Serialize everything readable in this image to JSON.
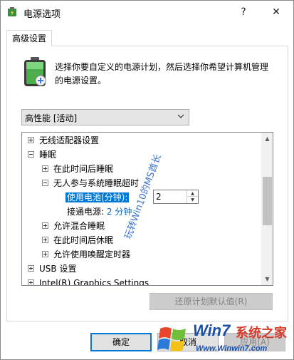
{
  "window": {
    "title": "电源选项",
    "help": "?",
    "close": "✕"
  },
  "tab": {
    "label": "高级设置"
  },
  "description": "选择你要自定义的电源计划，然后选择你希望计算机管理的电源设置。",
  "plan_select": {
    "value": "高性能 [活动]"
  },
  "tree": {
    "wireless": "无线适配器设置",
    "sleep": "睡眠",
    "sleep_after": "在此时间后睡眠",
    "unattended_timeout": "无人参与系统睡眠超时",
    "on_battery_label": "使用电池(分钟):",
    "on_battery_value": "2",
    "plugged_in_label": "接通电源:",
    "plugged_in_value": "2 分钟",
    "hybrid_sleep": "允许混合睡眠",
    "hibernate_after": "在此时间后休眠",
    "wake_timers": "允许使用唤醒定时器",
    "usb": "USB 设置",
    "intel": "Intel(R) Graphics Settings"
  },
  "buttons": {
    "restore": "还原计划默认值(R)",
    "ok": "确定",
    "cancel": "取消",
    "apply": "应用(A)"
  },
  "watermarks": {
    "vertical": "玩转Win10的MS酋长",
    "logo_brand": "Win7",
    "logo_cn": "系统之家",
    "logo_url": "Www.Winwin7.com"
  },
  "colors": {
    "accent": "#0078d7",
    "link": "#0066cc",
    "disabled_bg": "#cccccc"
  }
}
